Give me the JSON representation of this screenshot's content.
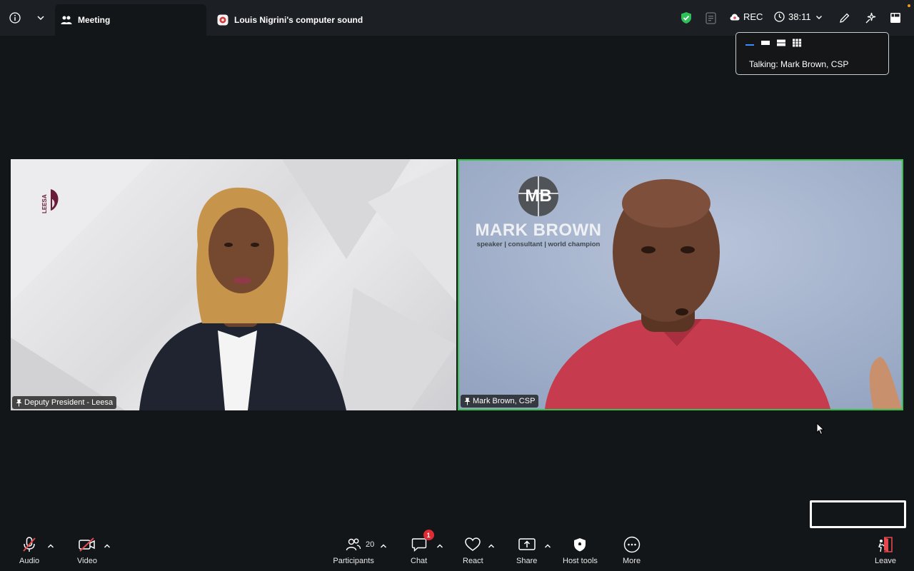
{
  "topbar": {
    "tabs": [
      {
        "label": "Meeting",
        "active": true
      },
      {
        "label": "Louis Nigrini's computer sound",
        "active": false
      }
    ],
    "rec_label": "REC",
    "timer": "38:11",
    "icons": [
      "info-icon",
      "chevron-down-icon",
      "shield-check-icon",
      "captions-icon",
      "cloud-record-icon",
      "clock-icon",
      "pencil-icon",
      "sparkle-icon",
      "view-icon"
    ]
  },
  "popover": {
    "talking": "Talking: Mark Brown, CSP"
  },
  "tiles": [
    {
      "name": "Deputy President - Leesa",
      "logo_text": "LEESA"
    },
    {
      "name": "Mark Brown, CSP",
      "logo_initials": "MB",
      "logo_title": "MARK BROWN",
      "logo_subtitle": "speaker | consultant | world champion"
    }
  ],
  "toolbar": {
    "audio": "Audio",
    "video": "Video",
    "participants": "Participants",
    "participants_count": "20",
    "chat": "Chat",
    "chat_badge": "1",
    "react": "React",
    "share": "Share",
    "host_tools": "Host tools",
    "more": "More",
    "leave": "Leave"
  },
  "colors": {
    "active_speaker_border": "#35c24a",
    "chat_badge": "#e02b35",
    "shield": "#2fc05a",
    "leave": "#e5484d"
  }
}
